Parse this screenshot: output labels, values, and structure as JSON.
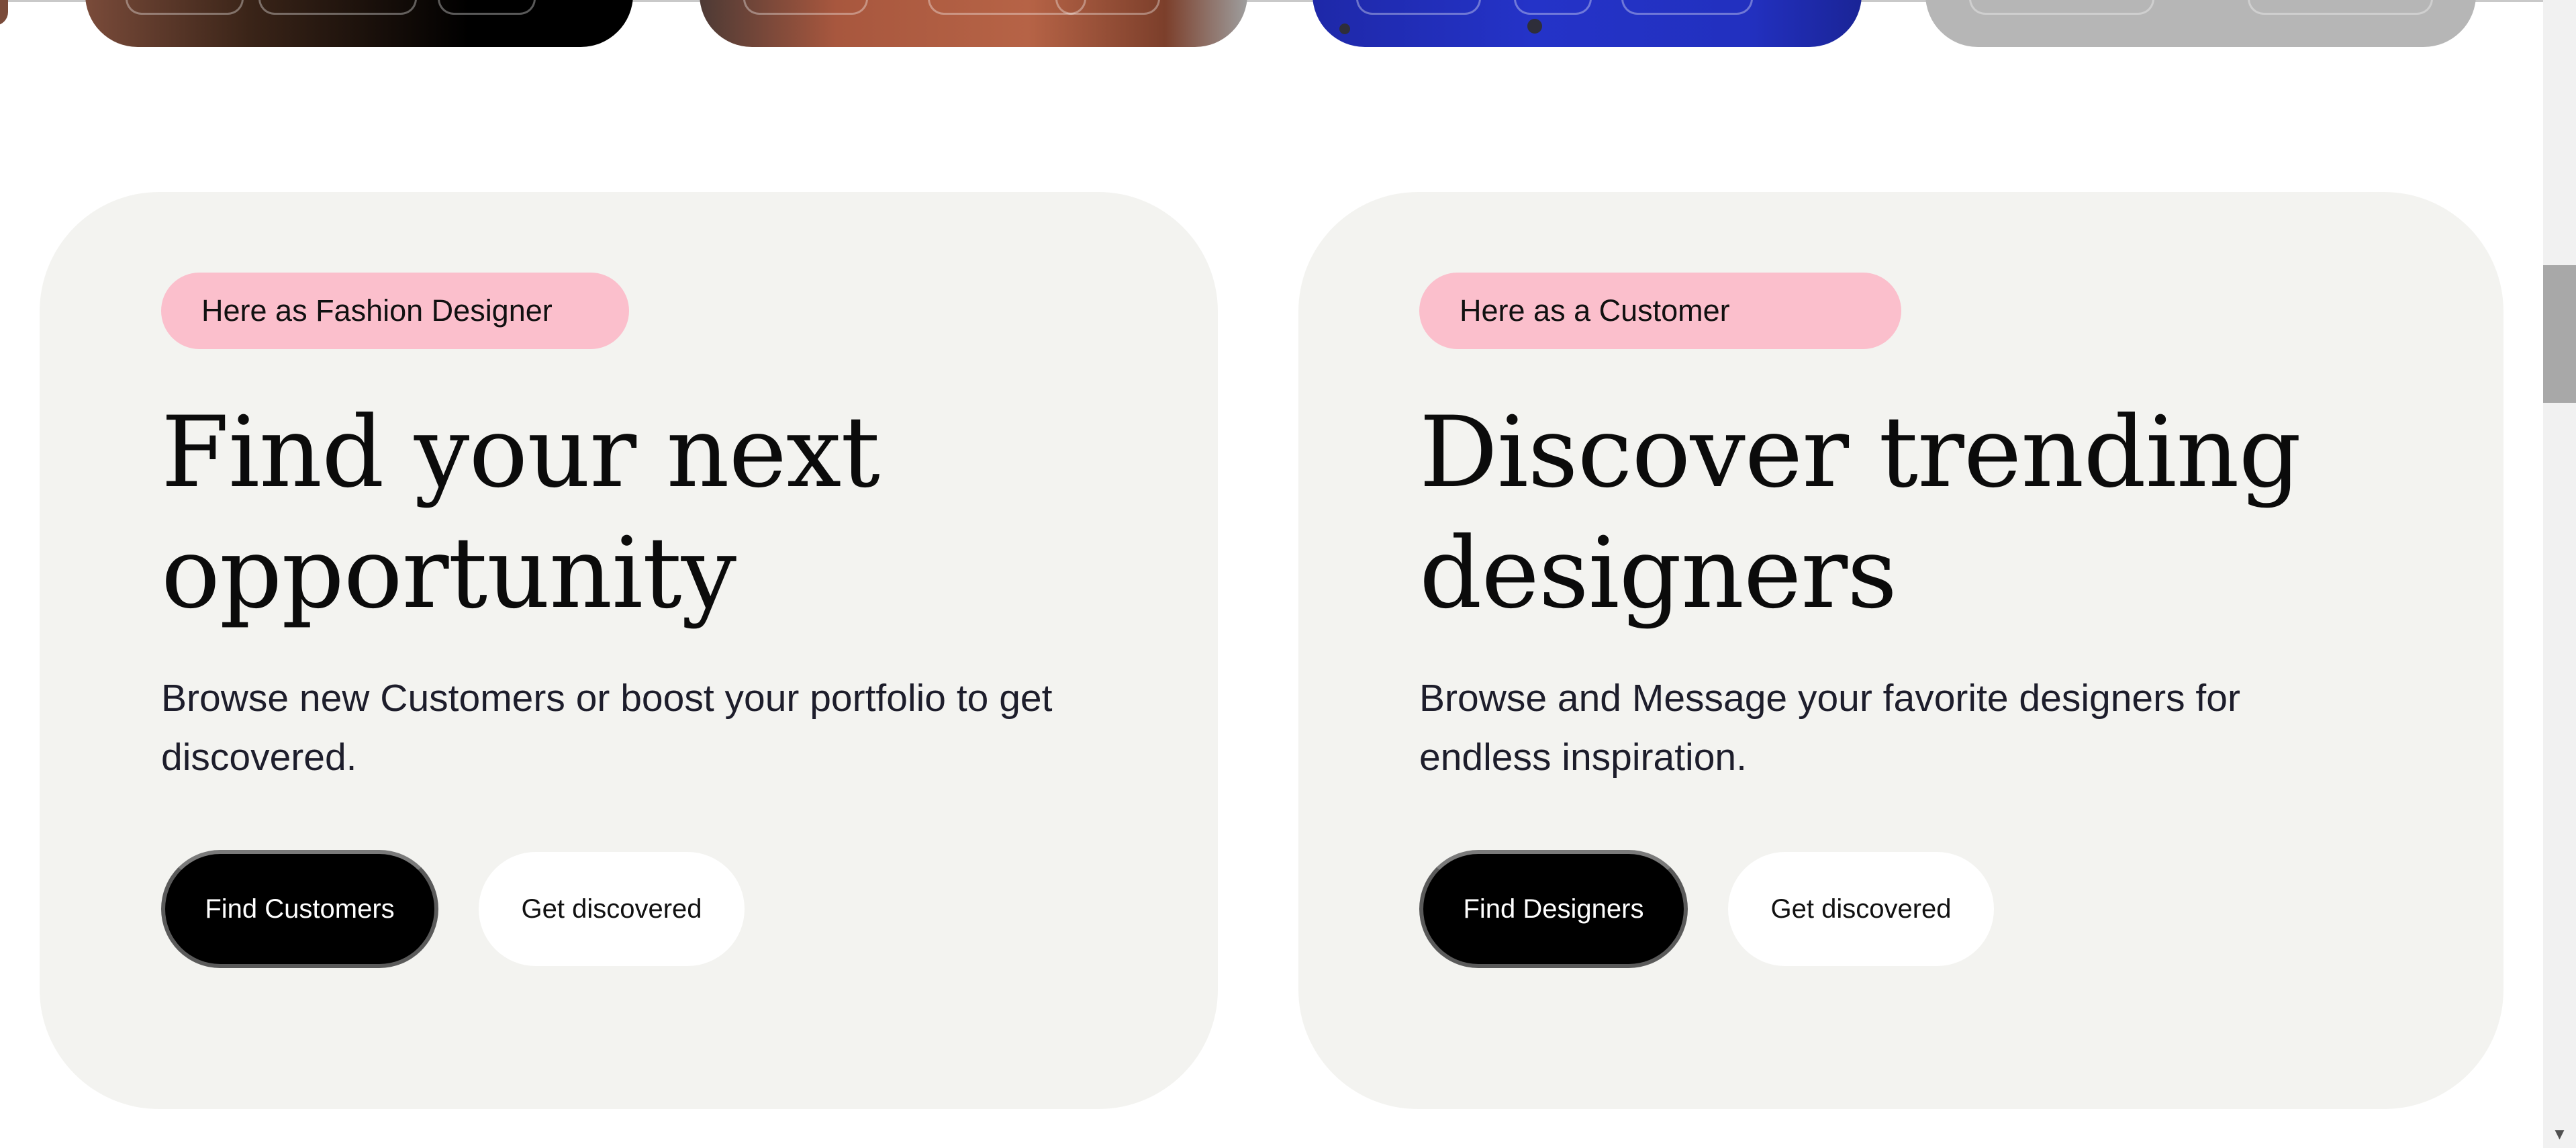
{
  "designer_card": {
    "badge": "Here as Fashion Designer",
    "headline": "Find your next opportunity",
    "description": "Browse new Customers or boost your portfolio to get discovered.",
    "primary_button": "Find Customers",
    "secondary_button": "Get discovered"
  },
  "customer_card": {
    "badge": "Here as a Customer",
    "headline": "Discover trending designers",
    "description": "Browse and Message your favorite designers for endless inspiration.",
    "primary_button": "Find Designers",
    "secondary_button": "Get discovered"
  },
  "image_strip": {
    "images": [
      "designer-photo-1",
      "designer-photo-2",
      "designer-photo-3",
      "designer-photo-4"
    ]
  },
  "scrollbar": {
    "down_arrow_icon": "chevron-down-icon"
  },
  "colors": {
    "card_background": "#f3f3f0",
    "badge_background": "#fbbfcc",
    "primary_button": "#000000",
    "secondary_button": "#ffffff"
  }
}
